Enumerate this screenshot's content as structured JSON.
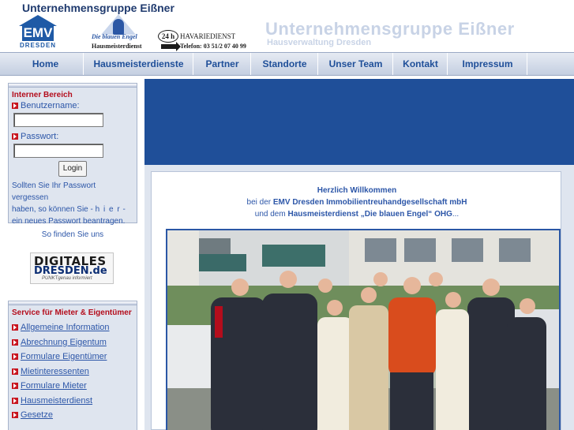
{
  "header": {
    "group_name": "Unternehmensgruppe Eißner",
    "emv_logo": {
      "main": "EMV",
      "sub": "DRESDEN"
    },
    "engel_logo": {
      "name": "Die blauen Engel",
      "sub": "Hausmeisterdienst"
    },
    "havarie": {
      "badge": "24 h",
      "title": "HAVARIEDIENST",
      "phone": "Telefon: 03 51/2 07 40 99"
    },
    "big_title": "Unternehmensgruppe Eißner",
    "big_subtitle": "Hausverwaltung Dresden"
  },
  "nav": {
    "items": [
      {
        "label": "Home"
      },
      {
        "label": "Hausmeisterdienste"
      },
      {
        "label": "Partner"
      },
      {
        "label": "Standorte"
      },
      {
        "label": "Unser Team"
      },
      {
        "label": "Kontakt"
      },
      {
        "label": "Impressum"
      }
    ]
  },
  "login": {
    "title": "Interner Bereich",
    "username_label": "Benutzername:",
    "username_value": "",
    "password_label": "Passwort:",
    "password_value": "",
    "button_label": "Login",
    "help_text_1": "Sollten Sie Ihr Passwort vergessen",
    "help_text_2": "haben, so können Sie -",
    "help_link": "h i e r",
    "help_text_3": "-",
    "help_text_4": "ein neues Passwort beantragen."
  },
  "find_us": "So finden Sie uns",
  "digitales": {
    "line1": "DIGITALES",
    "line2": "DRESDEN.de",
    "line3": "PUNKTgenau informiert"
  },
  "service": {
    "title": "Service für Mieter & Eigentümer",
    "links": [
      {
        "label": "Allgemeine Information"
      },
      {
        "label": "Abrechnung Eigentum"
      },
      {
        "label": "Formulare Eigentümer"
      },
      {
        "label": "Mietinteressenten"
      },
      {
        "label": "Formulare Mieter"
      },
      {
        "label": "Hausmeisterdienst"
      },
      {
        "label": "Gesetze"
      }
    ]
  },
  "welcome": {
    "line1": "Herzlich Willkommen",
    "line2_prefix": "bei der",
    "line2_bold": "EMV Dresden Immobilientreuhandgesellschaft mbH",
    "line3_prefix": "und dem",
    "line3_bold": "Hausmeisterdienst „Die blauen Engel“ OHG",
    "line3_suffix": "..."
  },
  "colors": {
    "brand_blue": "#1f4f99",
    "panel_bg": "#dfe5ef",
    "accent_red": "#b40d1c",
    "link_blue": "#2c56a8"
  }
}
